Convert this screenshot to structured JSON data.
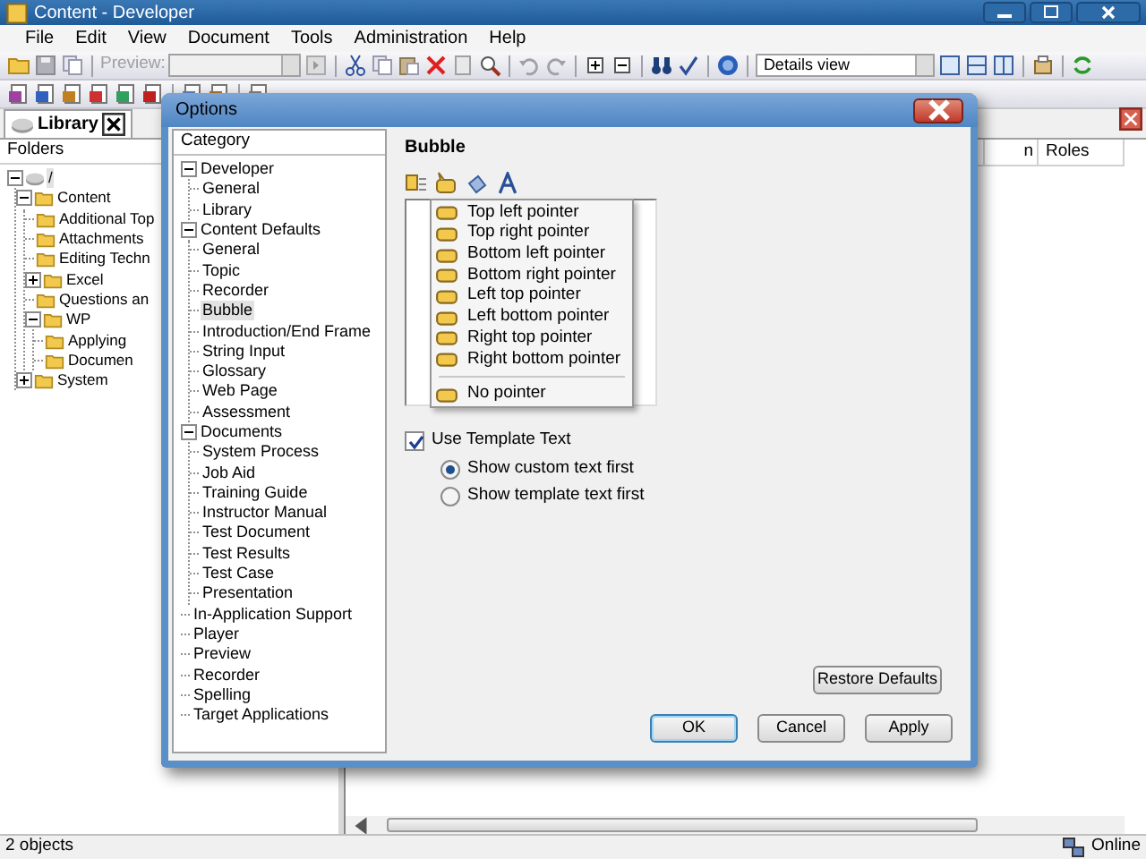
{
  "window": {
    "title": "Content - Developer"
  },
  "menu": [
    "File",
    "Edit",
    "View",
    "Document",
    "Tools",
    "Administration",
    "Help"
  ],
  "toolbar": {
    "preview_label": "Preview:",
    "view_select": "Details view"
  },
  "library_tab": {
    "label": "Library"
  },
  "folders_panel": {
    "header": "Folders",
    "tree": [
      {
        "label": "/",
        "selected": true,
        "expanded": true,
        "children": [
          {
            "label": "Content",
            "selected": false,
            "expanded": true,
            "children": [
              {
                "label": "Additional Top",
                "selected": false
              },
              {
                "label": "Attachments",
                "selected": false
              },
              {
                "label": "Editing Techn",
                "selected": false
              },
              {
                "label": "Excel",
                "selected": false,
                "expanded": false
              },
              {
                "label": "Questions an",
                "selected": false
              },
              {
                "label": "WP",
                "selected": false,
                "expanded": true,
                "children": [
                  {
                    "label": "Applying",
                    "selected": false
                  },
                  {
                    "label": "Documen",
                    "selected": false
                  }
                ]
              }
            ]
          },
          {
            "label": "System",
            "selected": false,
            "expanded": false
          }
        ]
      }
    ]
  },
  "content_panel": {
    "columns": [
      "n",
      "Roles"
    ]
  },
  "dialog": {
    "title": "Options",
    "category_header": "Category",
    "categories": [
      {
        "label": "Developer",
        "selected": false,
        "expanded": true,
        "children": [
          {
            "label": "General",
            "selected": false
          },
          {
            "label": "Library",
            "selected": false
          }
        ]
      },
      {
        "label": "Content Defaults",
        "selected": false,
        "expanded": true,
        "children": [
          {
            "label": "General",
            "selected": false
          },
          {
            "label": "Topic",
            "selected": false
          },
          {
            "label": "Recorder",
            "selected": false
          },
          {
            "label": "Bubble",
            "selected": true
          },
          {
            "label": "Introduction/End Frame",
            "selected": false
          },
          {
            "label": "String Input",
            "selected": false
          },
          {
            "label": "Glossary",
            "selected": false
          },
          {
            "label": "Web Page",
            "selected": false
          },
          {
            "label": "Assessment",
            "selected": false
          }
        ]
      },
      {
        "label": "Documents",
        "selected": false,
        "expanded": true,
        "children": [
          {
            "label": "System Process",
            "selected": false
          },
          {
            "label": "Job Aid",
            "selected": false
          },
          {
            "label": "Training Guide",
            "selected": false
          },
          {
            "label": "Instructor Manual",
            "selected": false
          },
          {
            "label": "Test Document",
            "selected": false
          },
          {
            "label": "Test Results",
            "selected": false
          },
          {
            "label": "Test Case",
            "selected": false
          },
          {
            "label": "Presentation",
            "selected": false
          }
        ]
      },
      {
        "label": "In-Application Support",
        "selected": false
      },
      {
        "label": "Player",
        "selected": false
      },
      {
        "label": "Preview",
        "selected": false
      },
      {
        "label": "Recorder",
        "selected": false
      },
      {
        "label": "Spelling",
        "selected": false
      },
      {
        "label": "Target Applications",
        "selected": false
      }
    ],
    "section_title": "Bubble",
    "pointer_menu": [
      {
        "label": "Top left pointer",
        "separator_before": false
      },
      {
        "label": "Top right pointer",
        "separator_before": false
      },
      {
        "label": "Bottom left pointer",
        "separator_before": false
      },
      {
        "label": "Bottom right pointer",
        "separator_before": false
      },
      {
        "label": "Left top pointer",
        "separator_before": false
      },
      {
        "label": "Left bottom pointer",
        "separator_before": false
      },
      {
        "label": "Right top pointer",
        "separator_before": false
      },
      {
        "label": "Right bottom pointer",
        "separator_before": false
      },
      {
        "label": "No pointer",
        "separator_before": true
      }
    ],
    "use_template_text": {
      "label": "Use Template Text",
      "checked": true
    },
    "text_order": [
      {
        "label": "Show custom text first",
        "selected": true
      },
      {
        "label": "Show template text first",
        "selected": false
      }
    ],
    "buttons": {
      "restore": "Restore Defaults",
      "ok": "OK",
      "cancel": "Cancel",
      "apply": "Apply"
    }
  },
  "status_bar": {
    "text": "2 objects",
    "connection": "Online"
  }
}
